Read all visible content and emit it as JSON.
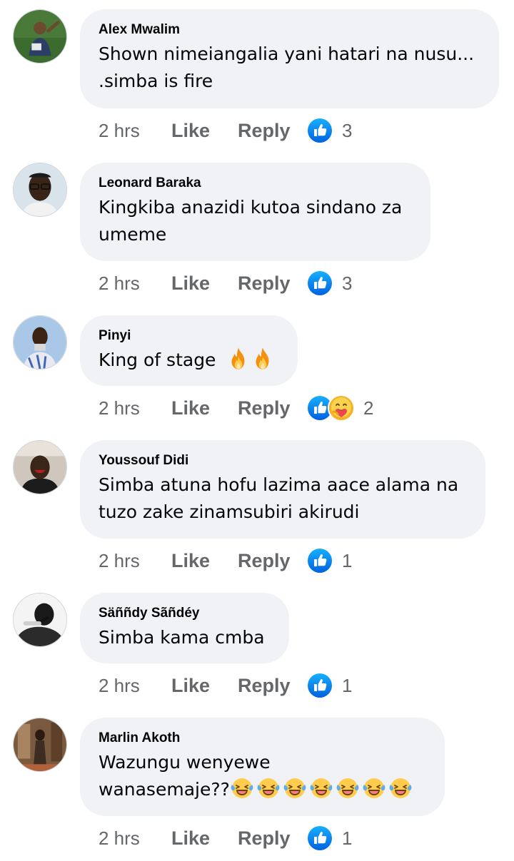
{
  "comments": [
    {
      "author": "Alex Mwalim",
      "text_lines": [
        "Shown nimeiangalia yani hatari na nusu...",
        ".simba is fire"
      ],
      "time": "2 hrs",
      "like_label": "Like",
      "reply_label": "Reply",
      "reactions": [
        "like-icon"
      ],
      "reaction_count": "3"
    },
    {
      "author": "Leonard Baraka",
      "text_lines": [
        "Kingkiba anazidi kutoa sindano za",
        "umeme"
      ],
      "time": "2 hrs",
      "like_label": "Like",
      "reply_label": "Reply",
      "reactions": [
        "like-icon"
      ],
      "reaction_count": "3"
    },
    {
      "author": "Pinyi",
      "text_lines": [
        "King of stage"
      ],
      "text_emojis": [
        "fire-emoji",
        "fire-emoji"
      ],
      "time": "2 hrs",
      "like_label": "Like",
      "reply_label": "Reply",
      "reactions": [
        "like-icon",
        "care-icon"
      ],
      "reaction_count": "2"
    },
    {
      "author": "Youssouf Didi",
      "text_lines": [
        "Simba atuna hofu lazima aace alama na",
        "tuzo zake zinamsubiri akirudi"
      ],
      "time": "2 hrs",
      "like_label": "Like",
      "reply_label": "Reply",
      "reactions": [
        "like-icon"
      ],
      "reaction_count": "1"
    },
    {
      "author": "Säññdy Sãñdéy",
      "text_lines": [
        "Simba kama cmba"
      ],
      "time": "2 hrs",
      "like_label": "Like",
      "reply_label": "Reply",
      "reactions": [
        "like-icon"
      ],
      "reaction_count": "1"
    },
    {
      "author": "Marlin Akoth",
      "text_lines": [
        "Wazungu wenyewe",
        "wanasemaje??"
      ],
      "text_emojis": [
        "laughing-tears-emoji",
        "laughing-tears-emoji",
        "laughing-tears-emoji",
        "laughing-tears-emoji",
        "laughing-tears-emoji",
        "laughing-tears-emoji",
        "laughing-tears-emoji"
      ],
      "time": "2 hrs",
      "like_label": "Like",
      "reply_label": "Reply",
      "reactions": [
        "like-icon"
      ],
      "reaction_count": "1"
    }
  ],
  "colors": {
    "bubble": "#f0f2f5",
    "meta_text": "#65676b",
    "like_blue": "#1877f2",
    "name_text": "#050505"
  }
}
